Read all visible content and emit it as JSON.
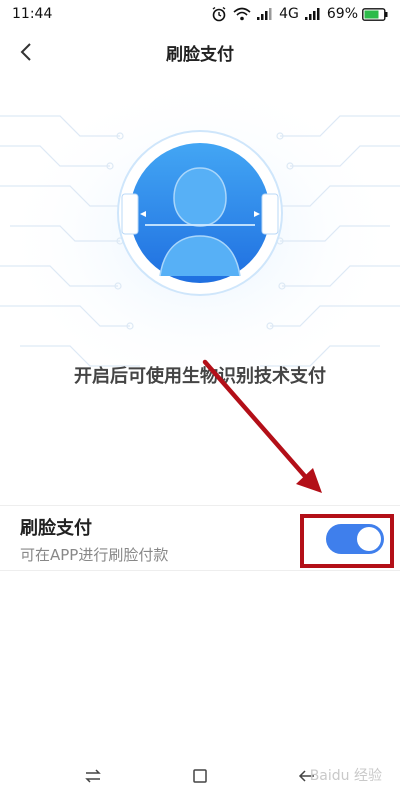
{
  "status_bar": {
    "time": "11:44",
    "network": "4G",
    "battery": "69%"
  },
  "nav": {
    "title": "刷脸支付"
  },
  "hero": {
    "description": "开启后可使用生物识别技术支付"
  },
  "setting": {
    "title": "刷脸支付",
    "subtitle": "可在APP进行刷脸付款",
    "enabled": true
  },
  "colors": {
    "accent": "#3f7fec",
    "highlight": "#b30f18",
    "arrow": "#b30f18"
  },
  "watermark": "Baidu 经验"
}
